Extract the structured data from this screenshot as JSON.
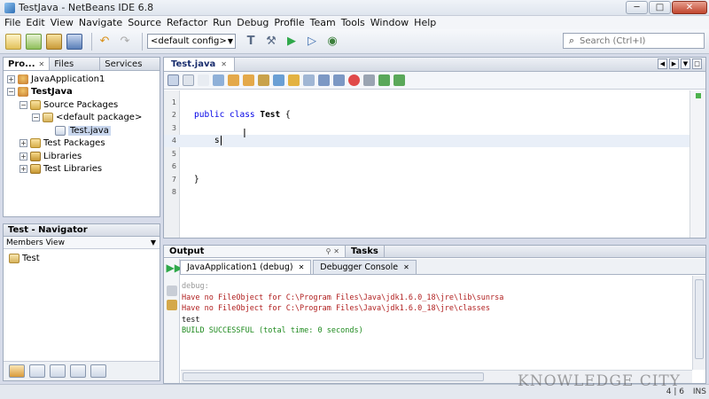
{
  "window": {
    "title": "TestJava - NetBeans IDE 6.8",
    "min_label": "─",
    "max_label": "□",
    "close_label": "✕"
  },
  "menu": [
    "File",
    "Edit",
    "View",
    "Navigate",
    "Source",
    "Refactor",
    "Run",
    "Debug",
    "Profile",
    "Team",
    "Tools",
    "Window",
    "Help"
  ],
  "toolbar": {
    "config_value": "<default config>",
    "search_placeholder": "Search (Ctrl+I)"
  },
  "projects_panel": {
    "tabs": [
      "Pro...",
      "Files",
      "Services"
    ],
    "tree": [
      {
        "label": "JavaApplication1",
        "indent": 0,
        "toggle": "+",
        "icon": "cup"
      },
      {
        "label": "TestJava",
        "indent": 0,
        "toggle": "−",
        "icon": "cup",
        "bold": true
      },
      {
        "label": "Source Packages",
        "indent": 1,
        "toggle": "−",
        "icon": "folder"
      },
      {
        "label": "<default package>",
        "indent": 2,
        "toggle": "−",
        "icon": "pkg"
      },
      {
        "label": "Test.java",
        "indent": 3,
        "toggle": "",
        "icon": "java",
        "selected": true
      },
      {
        "label": "Test Packages",
        "indent": 1,
        "toggle": "+",
        "icon": "folder"
      },
      {
        "label": "Libraries",
        "indent": 1,
        "toggle": "+",
        "icon": "lib"
      },
      {
        "label": "Test Libraries",
        "indent": 1,
        "toggle": "+",
        "icon": "lib"
      }
    ]
  },
  "navigator": {
    "title": "Test - Navigator",
    "view": "Members View",
    "items": [
      "Test"
    ]
  },
  "editor": {
    "tab": "Test.java",
    "lines": [
      {
        "num": "1",
        "text": ""
      },
      {
        "num": "2",
        "kw": "public class ",
        "cls": "Test",
        "rest": " {"
      },
      {
        "num": "3",
        "text": ""
      },
      {
        "num": "4",
        "text": "    s",
        "current": true
      },
      {
        "num": "5",
        "text": ""
      },
      {
        "num": "6",
        "text": ""
      },
      {
        "num": "7",
        "text": "}"
      },
      {
        "num": "8",
        "text": ""
      }
    ]
  },
  "output": {
    "title": "Output",
    "tasks_tab": "Tasks",
    "subtabs": [
      "JavaApplication1 (debug)",
      "Debugger Console"
    ],
    "lines": [
      {
        "text": "debug:",
        "color": "gray"
      },
      {
        "text": "Have no FileObject for C:\\Program Files\\Java\\jdk1.6.0_18\\jre\\lib\\sunrsa",
        "color": "red"
      },
      {
        "text": "Have no FileObject for C:\\Program Files\\Java\\jdk1.6.0_18\\jre\\classes",
        "color": "red"
      },
      {
        "text": "test",
        "color": "black"
      },
      {
        "text": "BUILD SUCCESSFUL (total time: 0 seconds)",
        "color": "green"
      }
    ]
  },
  "status": {
    "position": "4 | 6",
    "mode": "INS"
  },
  "watermark": "KNOWLEDGE CITY"
}
